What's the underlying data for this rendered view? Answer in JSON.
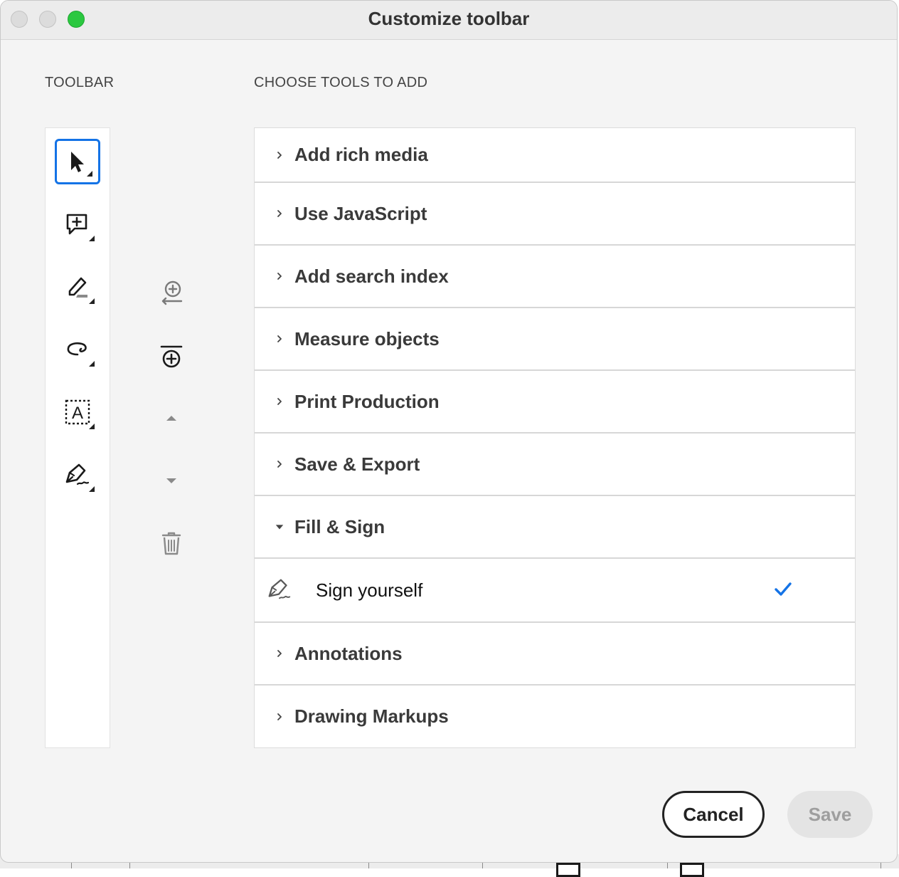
{
  "window": {
    "title": "Customize toolbar"
  },
  "left": {
    "label": "TOOLBAR",
    "tools": [
      {
        "name": "select-tool",
        "icon": "arrow-cursor-icon",
        "selected": true
      },
      {
        "name": "comment-tool",
        "icon": "add-comment-icon"
      },
      {
        "name": "highlight-tool",
        "icon": "highlighter-icon"
      },
      {
        "name": "draw-tool",
        "icon": "freehand-loop-icon"
      },
      {
        "name": "text-select-tool",
        "icon": "text-box-icon"
      },
      {
        "name": "sign-tool",
        "icon": "pen-sign-icon"
      }
    ],
    "actions": [
      {
        "name": "add-separator-button",
        "icon": "add-separator-icon"
      },
      {
        "name": "add-divider-button",
        "icon": "add-divider-icon"
      },
      {
        "name": "move-up-button",
        "icon": "triangle-up-icon"
      },
      {
        "name": "move-down-button",
        "icon": "triangle-down-icon"
      },
      {
        "name": "delete-button",
        "icon": "trash-icon"
      }
    ]
  },
  "right": {
    "label": "CHOOSE TOOLS TO ADD",
    "categories": [
      {
        "label": "Add rich media",
        "expanded": false
      },
      {
        "label": "Use JavaScript",
        "expanded": false
      },
      {
        "label": "Add search index",
        "expanded": false
      },
      {
        "label": "Measure objects",
        "expanded": false
      },
      {
        "label": "Print Production",
        "expanded": false
      },
      {
        "label": "Save & Export",
        "expanded": false
      },
      {
        "label": "Fill & Sign",
        "expanded": true,
        "items": [
          {
            "label": "Sign yourself",
            "checked": true,
            "icon": "pen-sign-icon"
          }
        ]
      },
      {
        "label": "Annotations",
        "expanded": false
      },
      {
        "label": "Drawing Markups",
        "expanded": false
      }
    ]
  },
  "buttons": {
    "cancel": "Cancel",
    "save": "Save"
  },
  "colors": {
    "accent": "#1473e6",
    "close_dot": "#dcdcdc",
    "zoom_dot": "#2bc840"
  }
}
